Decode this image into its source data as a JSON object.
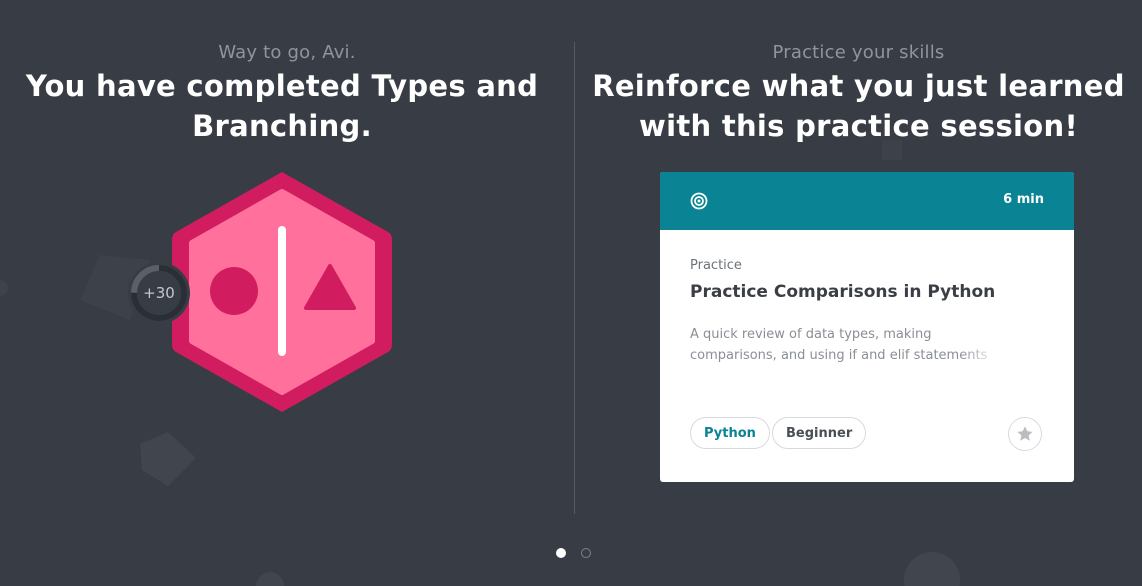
{
  "completion": {
    "eyebrow": "Way to go, Avi.",
    "headline_line1": "You have completed Types and",
    "headline_line2": "Branching.",
    "xp_label": "+30",
    "xp_progress_fraction": 0.75
  },
  "practice": {
    "eyebrow": "Practice your skills",
    "headline_line1": "Reinforce what you just learned",
    "headline_line2": "with this practice session!",
    "card": {
      "icon": "target-icon",
      "duration": "6 min",
      "kind": "Practice",
      "title": "Practice Comparisons in Python",
      "description_line1": "A quick review of data types, making",
      "description_line2": "comparisons, and using if and elif statements",
      "tags": [
        "Python",
        "Beginner"
      ],
      "bookmark_icon": "star-icon"
    }
  },
  "carousel": {
    "page_count": 2,
    "active_index": 0
  },
  "colors": {
    "background": "#383d45",
    "badge_outer": "#d11d5f",
    "badge_inner": "#ff709c",
    "card_header": "#0a8394",
    "accent_text": "#0a8394"
  }
}
